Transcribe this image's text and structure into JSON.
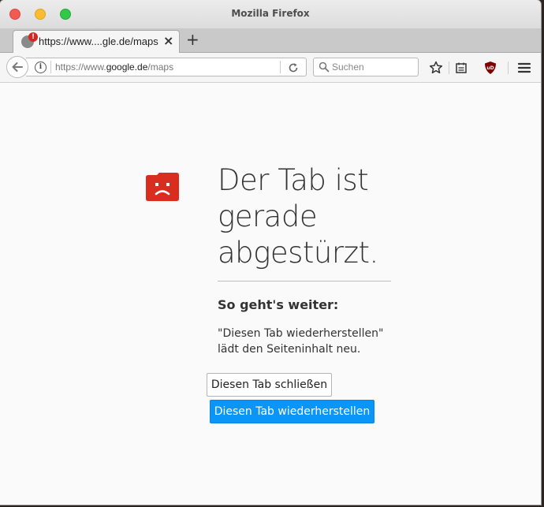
{
  "window": {
    "title": "Mozilla Firefox"
  },
  "tabs": [
    {
      "label": "https://www....gle.de/maps",
      "crashed": true,
      "badge": "!"
    }
  ],
  "navbar": {
    "url_prefix": "https://www.",
    "url_host": "google.de",
    "url_path": "/maps",
    "search_placeholder": "Suchen",
    "icons": [
      "back-icon",
      "info-icon",
      "reload-icon",
      "search-icon",
      "star-icon",
      "reader-list-icon",
      "ublock-icon",
      "menu-icon"
    ],
    "ublock_label": "uD"
  },
  "crash_page": {
    "heading": "Der Tab ist gerade abgestürzt.",
    "subheading": "So geht's weiter:",
    "description": "\"Diesen Tab wiederherstellen\" lädt den Seiteninhalt neu.",
    "close_button": "Diesen Tab schließen",
    "restore_button": "Diesen Tab wiederherstellen"
  },
  "colors": {
    "accent": "#0996f8",
    "crash_icon": "#d92d20",
    "close_light": "#f25a52",
    "minimize_light": "#fbbd2f",
    "maximize_light": "#34c84a"
  }
}
